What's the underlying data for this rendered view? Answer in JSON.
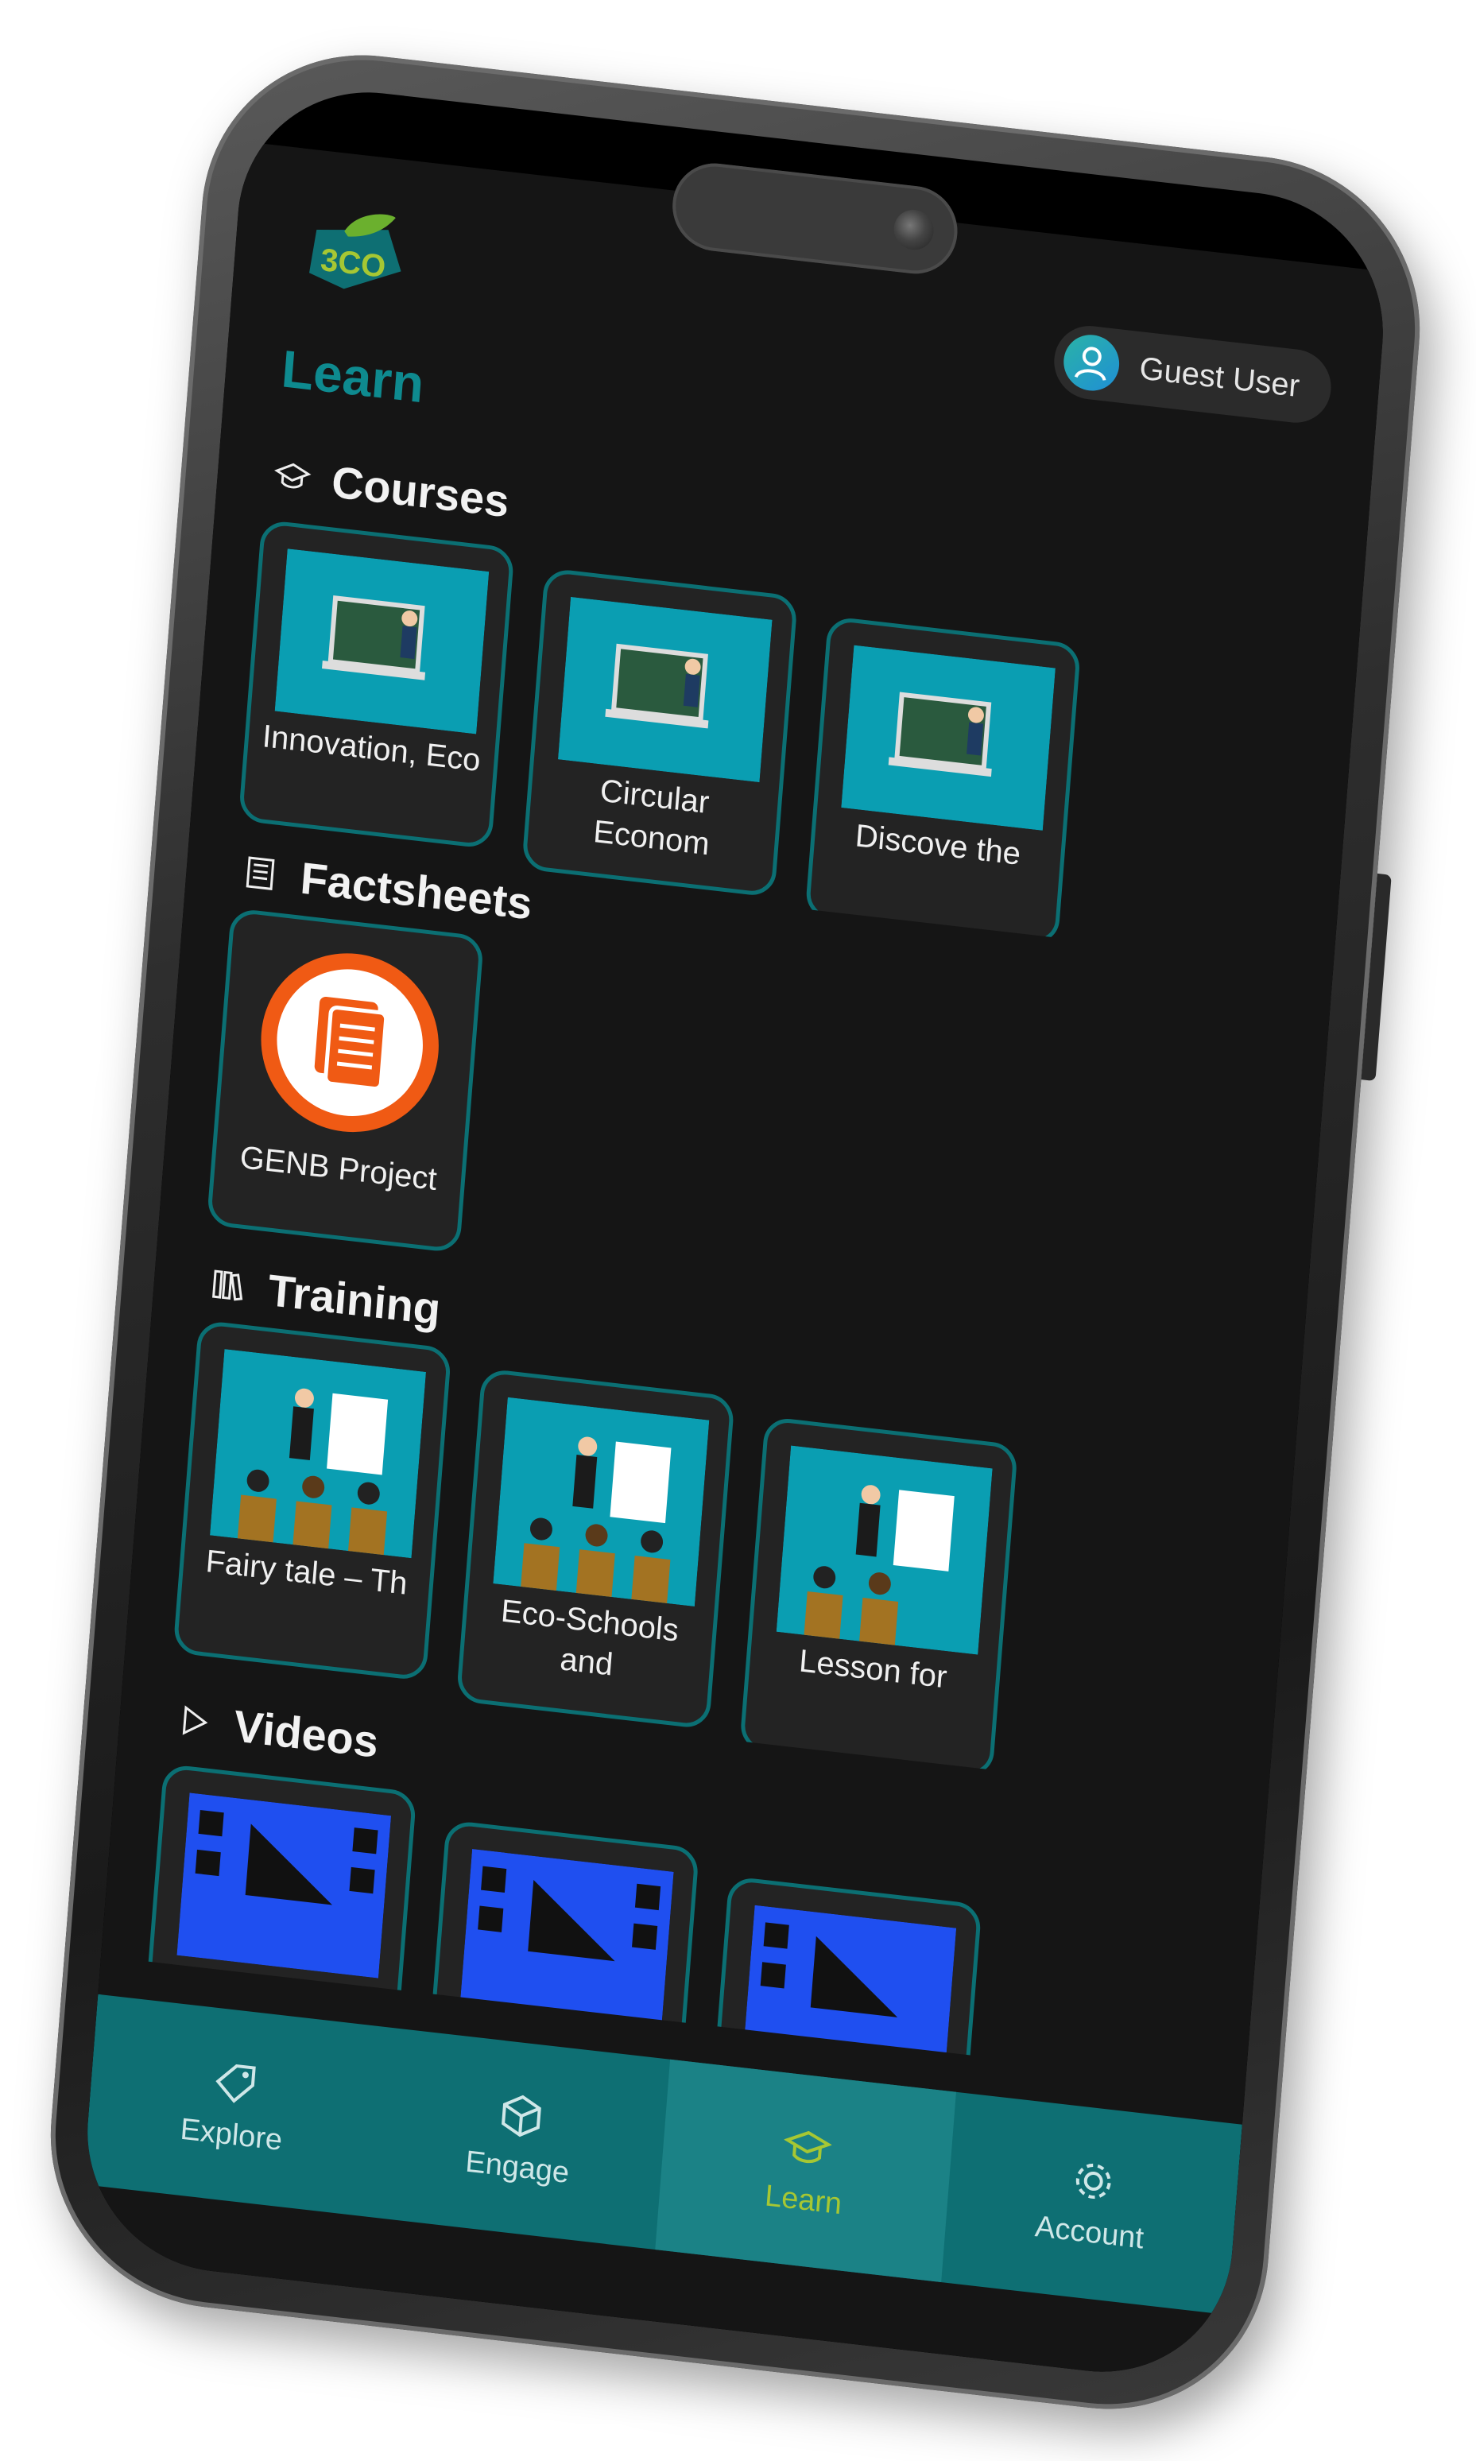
{
  "app": {
    "logo_text": "3CO",
    "page_title": "Learn"
  },
  "user": {
    "label": "Guest User"
  },
  "sections": {
    "courses": {
      "title": "Courses",
      "icon": "graduation-cap-icon",
      "items": [
        {
          "label": "Innovation, Eco"
        },
        {
          "label": "Circular Econom"
        },
        {
          "label": "Discove the"
        }
      ]
    },
    "factsheets": {
      "title": "Factsheets",
      "icon": "newspaper-icon",
      "items": [
        {
          "label": "GENB Project"
        }
      ]
    },
    "training": {
      "title": "Training",
      "icon": "books-icon",
      "items": [
        {
          "label": "Fairy tale – Th"
        },
        {
          "label": "Eco-Schools and"
        },
        {
          "label": "Lesson for"
        }
      ]
    },
    "videos": {
      "title": "Videos",
      "icon": "play-icon",
      "items": [
        {
          "label": ""
        },
        {
          "label": ""
        },
        {
          "label": ""
        }
      ]
    }
  },
  "nav": {
    "items": [
      {
        "label": "Explore",
        "icon": "tag-icon"
      },
      {
        "label": "Engage",
        "icon": "cube-icon"
      },
      {
        "label": "Learn",
        "icon": "graduation-cap-icon",
        "active": true
      },
      {
        "label": "Account",
        "icon": "gear-icon"
      }
    ]
  },
  "colors": {
    "accent": "#0e8a8f",
    "card_border": "#0b6f73",
    "nav_bg": "#0e6f73",
    "nav_active_text": "#a6c733",
    "factsheet_orange": "#f05a14"
  }
}
